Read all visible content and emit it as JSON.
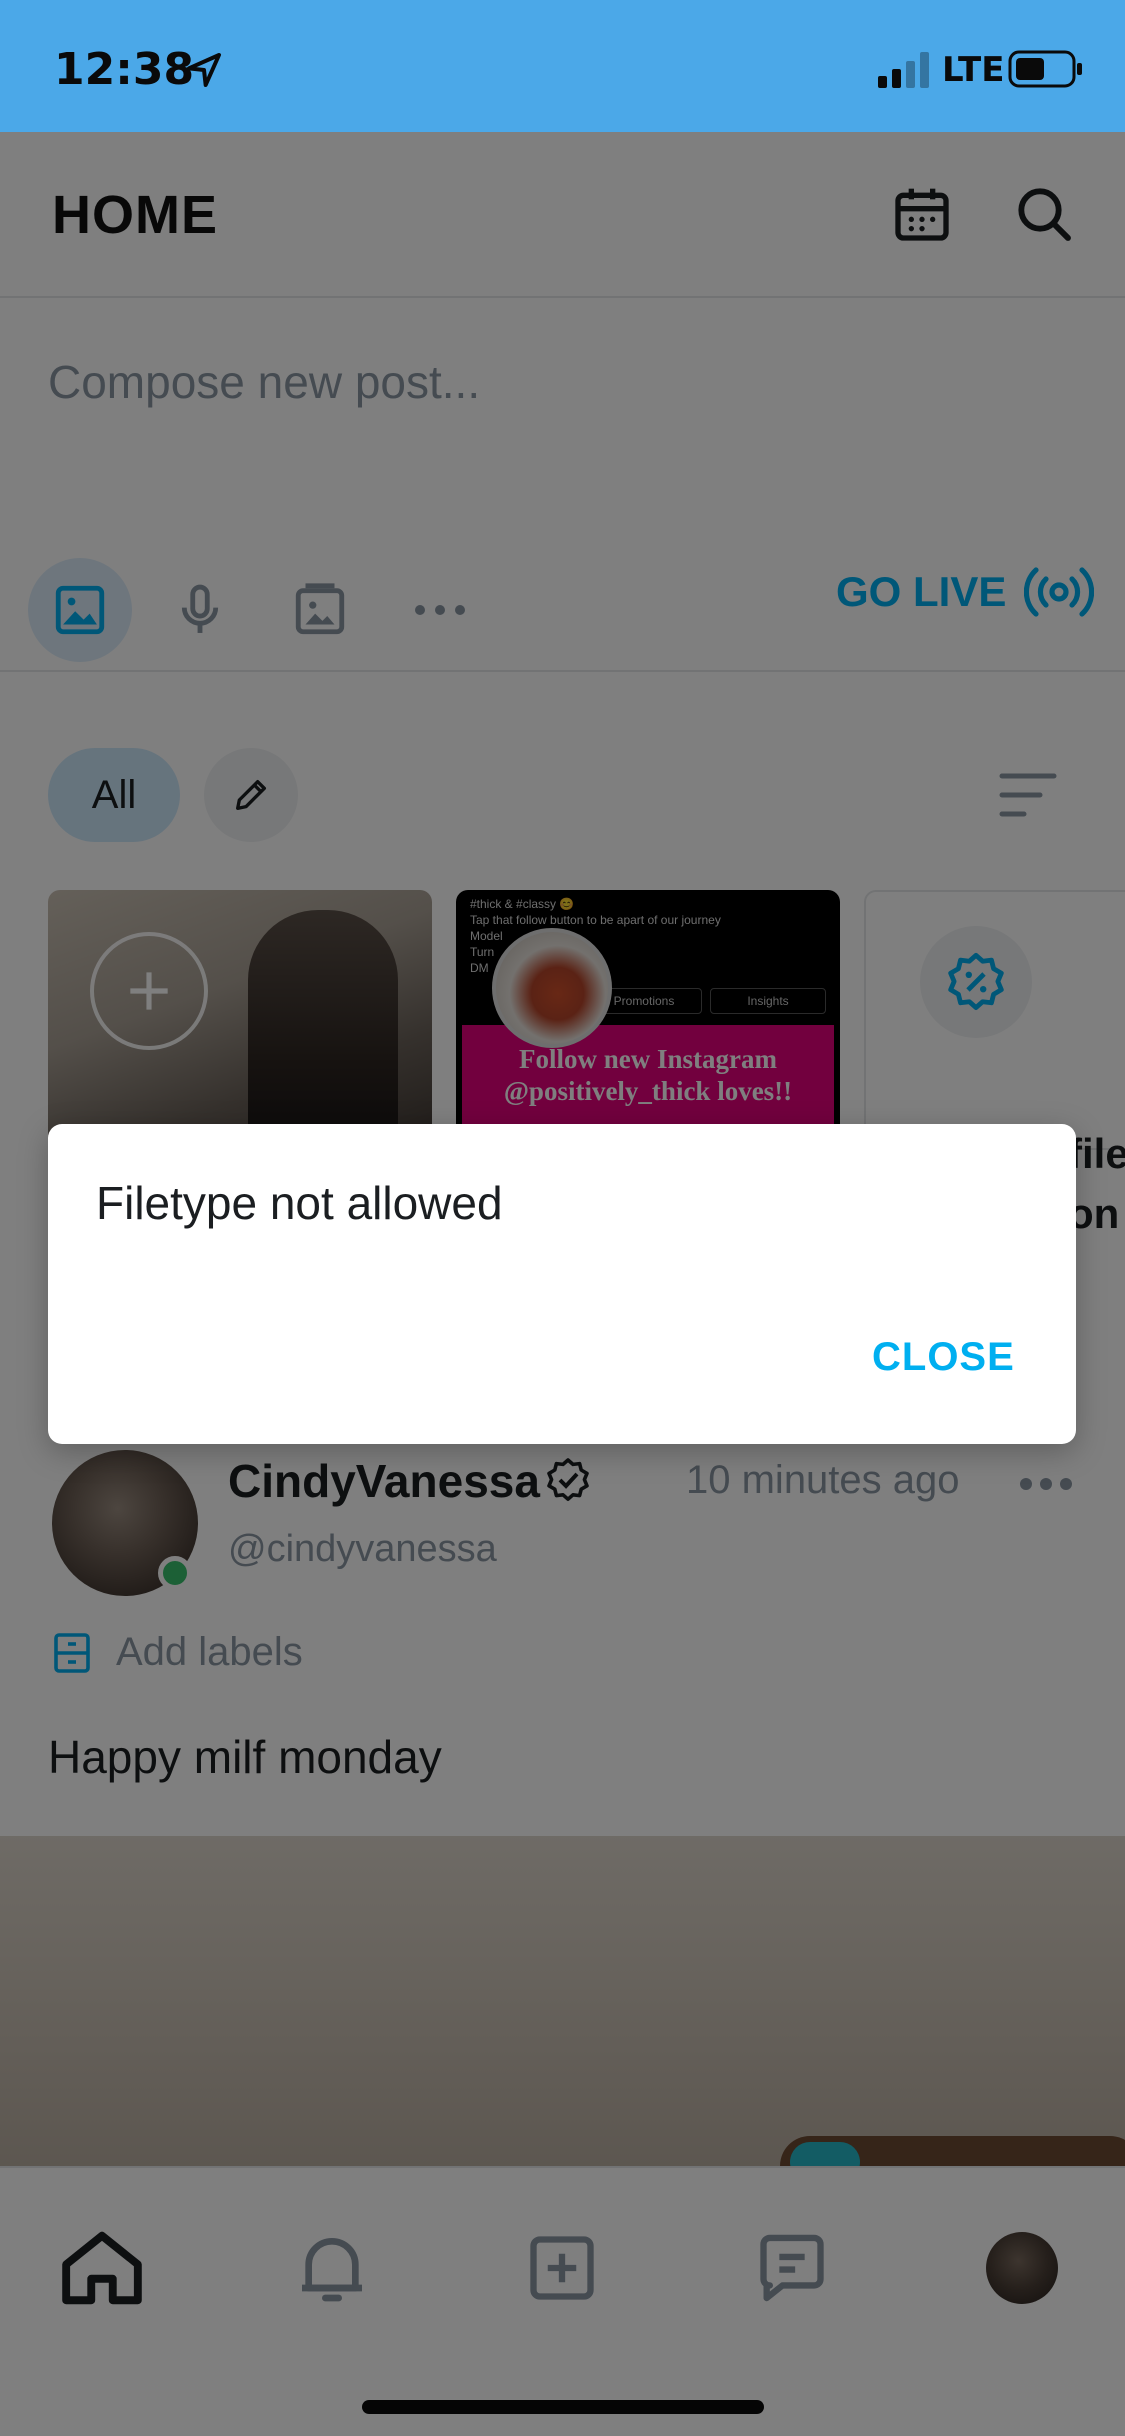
{
  "status_bar": {
    "time": "12:38",
    "network": "LTE"
  },
  "header": {
    "title": "HOME"
  },
  "composer": {
    "placeholder": "Compose new post...",
    "go_live_label": "GO LIVE"
  },
  "filters": {
    "all_label": "All"
  },
  "cards": {
    "instagram_lines": [
      "#thick & #classy 😊",
      "Tap that follow button to be apart of our journey",
      "Model",
      "Turn",
      "DM"
    ],
    "instagram_tabs": [
      "Promotions",
      "Insights"
    ],
    "instagram_banner": [
      "Follow new Instagram",
      "@positively_thick loves!!"
    ],
    "third_card_partial": [
      "file",
      "on"
    ]
  },
  "post": {
    "display_name": "CindyVanessa",
    "handle": "@cindyvanessa",
    "time": "10 minutes ago",
    "labels_action": "Add labels",
    "text": "Happy milf monday"
  },
  "dialog": {
    "message": "Filetype not allowed",
    "close_label": "CLOSE"
  },
  "colors": {
    "status_bar": "#4ba8e8",
    "accent": "#00aff0",
    "online": "#39c16c",
    "muted": "#8a96a3"
  }
}
